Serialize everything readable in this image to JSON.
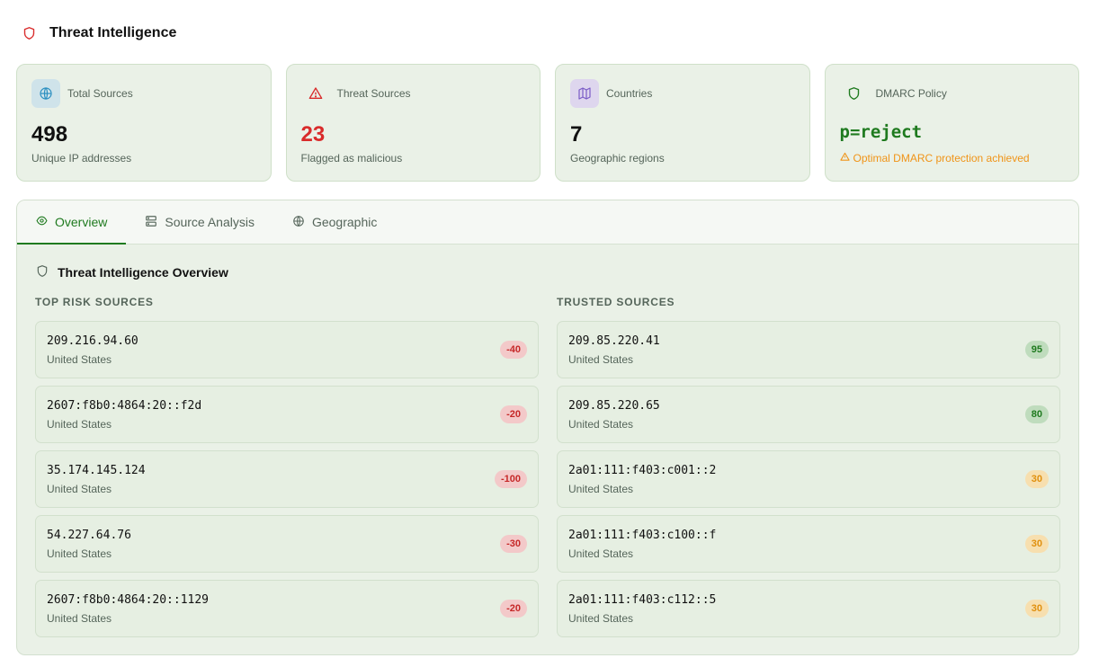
{
  "header": {
    "title": "Threat Intelligence",
    "icon": "shield-icon"
  },
  "colors": {
    "accent": "#1f7a1f",
    "danger": "#d92b2b",
    "warning": "#f09418"
  },
  "cards": [
    {
      "label": "Total Sources",
      "value": "498",
      "sub": "Unique IP addresses",
      "icon": "globe-icon"
    },
    {
      "label": "Threat Sources",
      "value": "23",
      "sub": "Flagged as malicious",
      "icon": "alert-triangle-icon"
    },
    {
      "label": "Countries",
      "value": "7",
      "sub": "Geographic regions",
      "icon": "map-icon"
    },
    {
      "label": "DMARC Policy",
      "value": "p=reject",
      "sub": "Optimal DMARC protection achieved",
      "icon": "shield-icon"
    }
  ],
  "tabs": [
    {
      "label": "Overview",
      "icon": "eye-icon",
      "active": true
    },
    {
      "label": "Source Analysis",
      "icon": "server-icon",
      "active": false
    },
    {
      "label": "Geographic",
      "icon": "globe-icon",
      "active": false
    }
  ],
  "overview": {
    "title": "Threat Intelligence Overview",
    "risk_heading": "TOP RISK SOURCES",
    "trusted_heading": "TRUSTED SOURCES",
    "risk_sources": [
      {
        "ip": "209.216.94.60",
        "country": "United States",
        "score": "-40"
      },
      {
        "ip": "2607:f8b0:4864:20::f2d",
        "country": "United States",
        "score": "-20"
      },
      {
        "ip": "35.174.145.124",
        "country": "United States",
        "score": "-100"
      },
      {
        "ip": "54.227.64.76",
        "country": "United States",
        "score": "-30"
      },
      {
        "ip": "2607:f8b0:4864:20::1129",
        "country": "United States",
        "score": "-20"
      }
    ],
    "trusted_sources": [
      {
        "ip": "209.85.220.41",
        "country": "United States",
        "score": "95",
        "level": "good"
      },
      {
        "ip": "209.85.220.65",
        "country": "United States",
        "score": "80",
        "level": "good"
      },
      {
        "ip": "2a01:111:f403:c001::2",
        "country": "United States",
        "score": "30",
        "level": "mid"
      },
      {
        "ip": "2a01:111:f403:c100::f",
        "country": "United States",
        "score": "30",
        "level": "mid"
      },
      {
        "ip": "2a01:111:f403:c112::5",
        "country": "United States",
        "score": "30",
        "level": "mid"
      }
    ]
  }
}
